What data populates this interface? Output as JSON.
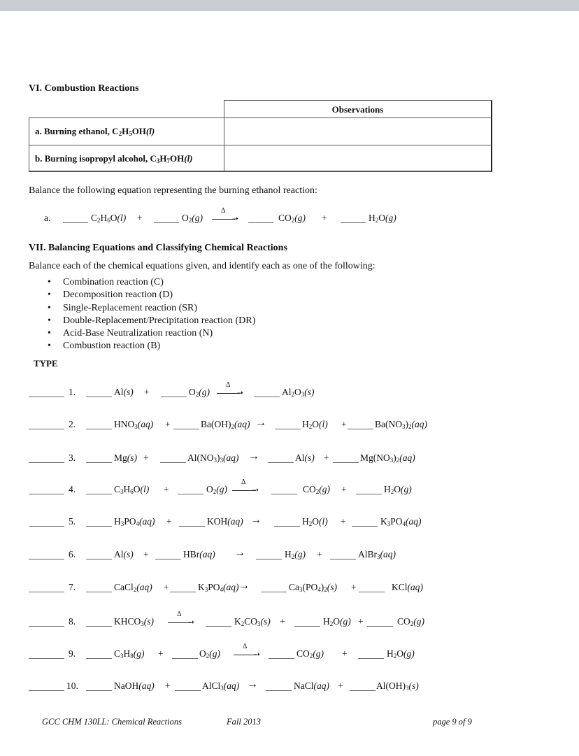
{
  "section6": {
    "title": "VI.  Combustion Reactions",
    "table": {
      "header": "Observations",
      "rows": [
        {
          "label_html": "a.  Burning ethanol, C<sub>2</sub>H<sub>5</sub>OH<i>(l)</i>",
          "label": "a.  Burning ethanol, C2H5OH(l)",
          "observation": ""
        },
        {
          "label_html": "b.  Burning isopropyl alcohol, C<sub>3</sub>H<sub>7</sub>OH<i>(l)</i>",
          "label": "b.  Burning isopropyl alcohol, C3H7OH(l)",
          "observation": ""
        }
      ]
    },
    "instruction": "Balance the following equation representing the burning ethanol reaction:",
    "equation": {
      "label": "a.",
      "terms": [
        "C<sub>2</sub>H<sub>6</sub>O<i>(l)</i>",
        "O<sub>2</sub><i>(g)</i>",
        "CO<sub>2</sub><i>(g)</i>",
        "H<sub>2</sub>O<i>(g)</i>"
      ],
      "arrow": "heat",
      "heat_symbol": "Δ"
    }
  },
  "section7": {
    "title": "VII. Balancing Equations and Classifying Chemical Reactions",
    "instruction": "Balance each of the chemical equations given, and identify each as one of the following:",
    "types": [
      "Combination reaction (C)",
      "Decomposition reaction (D)",
      "Single-Replacement reaction (SR)",
      "Double-Replacement/Precipitation reaction (DR)",
      "Acid-Base Neutralization reaction (N)",
      "Combustion reaction (B)"
    ],
    "type_header": "TYPE",
    "plus": "+",
    "equations": [
      {
        "num": "1.",
        "reactants": [
          "Al<i>(s)</i>",
          "O<sub>2</sub><i>(g)</i>"
        ],
        "arrow": "heat",
        "products": [
          "Al<sub>2</sub>O<sub>3</sub><i>(s)</i>"
        ]
      },
      {
        "num": "2.",
        "reactants": [
          "HNO<sub>3</sub><i>(aq)</i>",
          "Ba(OH)<sub>2</sub><i>(aq)</i>"
        ],
        "arrow": "plain",
        "products": [
          "H<sub>2</sub>O<i>(l)</i>",
          "Ba(NO<sub>3</sub>)<sub>2</sub><i>(aq)</i>"
        ]
      },
      {
        "num": "3.",
        "reactants": [
          "Mg<i>(s)</i>",
          "Al(NO<sub>3</sub>)<sub>3</sub><i>(aq)</i>"
        ],
        "arrow": "plain",
        "products": [
          "Al<i>(s)</i>",
          "Mg(NO<sub>3</sub>)<sub>2</sub><i>(aq)</i>"
        ]
      },
      {
        "num": "4.",
        "reactants": [
          "C<sub>3</sub>H<sub>6</sub>O<i>(l)</i>",
          "O<sub>2</sub><i>(g)</i>"
        ],
        "arrow": "heat",
        "products": [
          "CO<sub>2</sub><i>(g)</i>",
          "H<sub>2</sub>O<i>(g)</i>"
        ]
      },
      {
        "num": "5.",
        "reactants": [
          "H<sub>3</sub>PO<sub>4</sub><i>(aq)</i>",
          "KOH<i>(aq)</i>"
        ],
        "arrow": "plain",
        "products": [
          "H<sub>2</sub>O<i>(l)</i>",
          "K<sub>3</sub>PO<sub>4</sub><i>(aq)</i>"
        ]
      },
      {
        "num": "6.",
        "reactants": [
          "Al<i>(s)</i>",
          "HBr<i>(aq)</i>"
        ],
        "arrow": "plain",
        "products": [
          "H<sub>2</sub><i>(g)</i>",
          "AlBr<sub>3</sub><i>(aq)</i>"
        ]
      },
      {
        "num": "7.",
        "reactants": [
          "CaCl<sub>2</sub><i>(aq)</i>",
          "K<sub>3</sub>PO<sub>4</sub><i>(aq)</i>"
        ],
        "arrow": "plain",
        "products": [
          "Ca<sub>3</sub>(PO<sub>4</sub>)<sub>2</sub><i>(s)</i>",
          "KCl<i>(aq)</i>"
        ]
      },
      {
        "num": "8.",
        "reactants": [
          "KHCO<sub>3</sub><i>(s)</i>"
        ],
        "arrow": "heat",
        "products": [
          "K<sub>2</sub>CO<sub>3</sub><i>(s)</i>",
          "H<sub>2</sub>O<i>(g)</i>",
          "CO<sub>2</sub><i>(g)</i>"
        ]
      },
      {
        "num": "9.",
        "reactants": [
          "C<sub>3</sub>H<sub>8</sub><i>(g)</i>",
          "O<sub>2</sub><i>(g)</i>"
        ],
        "arrow": "heat",
        "products": [
          "CO<sub>2</sub><i>(g)</i>",
          "H<sub>2</sub>O<i>(g)</i>"
        ]
      },
      {
        "num": "10.",
        "reactants": [
          "NaOH<i>(aq)</i>",
          "AlCl<sub>3</sub><i>(aq)</i>"
        ],
        "arrow": "plain",
        "products": [
          "NaCl<i>(aq)</i>",
          "Al(OH)<sub>3</sub><i>(s)</i>"
        ]
      }
    ]
  },
  "footer": {
    "course": "GCC CHM 130LL: Chemical Reactions",
    "term": "Fall 2013",
    "page": "page 9 of 9"
  }
}
